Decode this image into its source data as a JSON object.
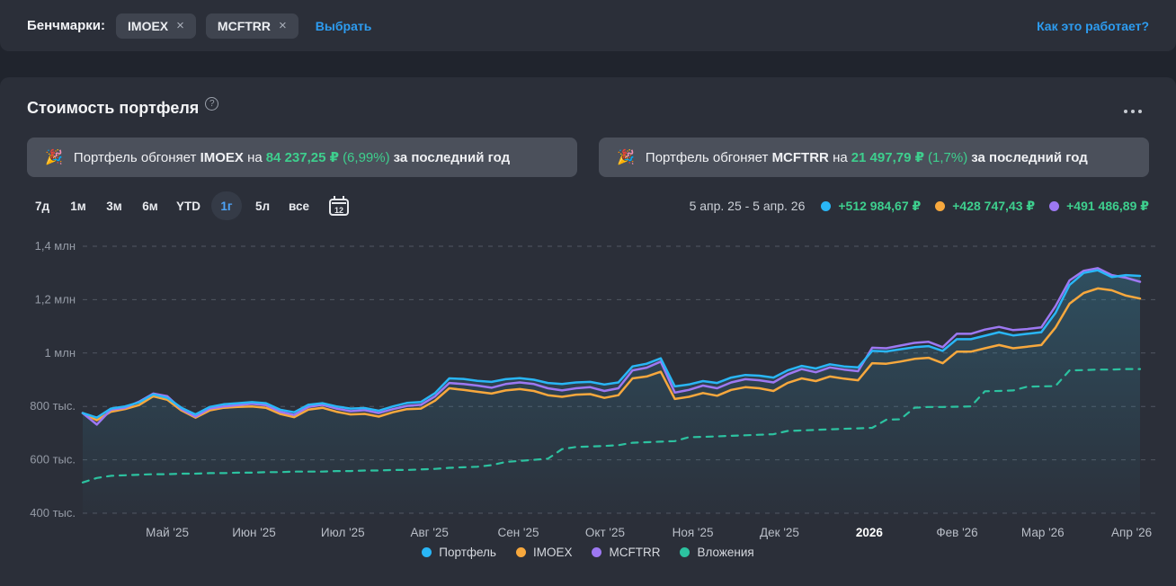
{
  "benchmark_bar": {
    "label": "Бенчмарки:",
    "chips": [
      {
        "label": "IMOEX"
      },
      {
        "label": "MCFTRR"
      }
    ],
    "remove_icon": "×",
    "select_link": "Выбрать",
    "help_link": "Как это работает?"
  },
  "portfolio_card": {
    "title": "Стоимость портфеля",
    "help_icon": "?",
    "banners": [
      {
        "emoji": "🎉",
        "prefix": "Портфель обгоняет",
        "benchmark": "IMOEX",
        "middle": "на",
        "amount": "84 237,25 ₽",
        "percent": "(6,99%)",
        "suffix": "за последний год"
      },
      {
        "emoji": "🎉",
        "prefix": "Портфель обгоняет",
        "benchmark": "MCFTRR",
        "middle": "на",
        "amount": "21 497,79 ₽",
        "percent": "(1,7%)",
        "suffix": "за последний год"
      }
    ],
    "periods": {
      "options": [
        "7д",
        "1м",
        "3м",
        "6м",
        "YTD",
        "1г",
        "5л",
        "все"
      ],
      "active": "1г",
      "calendar_label": "12"
    },
    "range": {
      "dates": "5 апр. 25 - 5 апр. 26",
      "stats": [
        {
          "color": "#29b6f6",
          "value": "+512 984,67 ₽"
        },
        {
          "color": "#f7a83d",
          "value": "+428 747,43 ₽"
        },
        {
          "color": "#9d78f2",
          "value": "+491 486,89 ₽"
        }
      ]
    }
  },
  "chart_data": {
    "type": "line",
    "title": "Стоимость портфеля",
    "unit": "тыс. ₽",
    "x_range": "5 апр. 25 - 5 апр. 26",
    "ylim": [
      370,
      1440
    ],
    "grid": "dashed-horizontal",
    "legend_position": "bottom-center",
    "y_ticks": [
      {
        "label": "1,4 млн",
        "value": 1400
      },
      {
        "label": "1,2 млн",
        "value": 1200
      },
      {
        "label": "1 млн",
        "value": 1000
      },
      {
        "label": "800 тыс.",
        "value": 800
      },
      {
        "label": "600 тыс.",
        "value": 600
      },
      {
        "label": "400 тыс.",
        "value": 400
      }
    ],
    "x_ticks": [
      {
        "label": "Май '25",
        "t": 0.08
      },
      {
        "label": "Июн '25",
        "t": 0.162
      },
      {
        "label": "Июл '25",
        "t": 0.246
      },
      {
        "label": "Авг '25",
        "t": 0.328
      },
      {
        "label": "Сен '25",
        "t": 0.412
      },
      {
        "label": "Окт '25",
        "t": 0.494
      },
      {
        "label": "Ноя '25",
        "t": 0.577
      },
      {
        "label": "Дек '25",
        "t": 0.659
      },
      {
        "label": "2026",
        "t": 0.744,
        "emphasis": true
      },
      {
        "label": "Фев '26",
        "t": 0.827
      },
      {
        "label": "Мар '26",
        "t": 0.908
      },
      {
        "label": "Апр '26",
        "t": 0.992
      }
    ],
    "series": [
      {
        "name": "Вложения",
        "color": "#2cc2a0",
        "dashed": true,
        "values": [
          515,
          532,
          540,
          542,
          544,
          546,
          546,
          548,
          548,
          550,
          550,
          552,
          552,
          554,
          554,
          556,
          556,
          556,
          558,
          558,
          560,
          560,
          562,
          562,
          564,
          566,
          570,
          572,
          574,
          580,
          592,
          596,
          600,
          604,
          640,
          648,
          650,
          652,
          655,
          664,
          666,
          668,
          670,
          685,
          686,
          688,
          690,
          692,
          694,
          696,
          708,
          710,
          712,
          714,
          716,
          718,
          720,
          750,
          752,
          795,
          798,
          798,
          799,
          800,
          857,
          858,
          860,
          874,
          875,
          876,
          935,
          936,
          938,
          938,
          940,
          940
        ]
      },
      {
        "name": "IMOEX",
        "color": "#f7a83d",
        "values": [
          775,
          748,
          780,
          790,
          805,
          838,
          825,
          785,
          758,
          785,
          795,
          798,
          800,
          795,
          772,
          760,
          788,
          795,
          780,
          770,
          772,
          762,
          778,
          790,
          792,
          822,
          868,
          862,
          855,
          848,
          860,
          865,
          858,
          842,
          836,
          844,
          846,
          832,
          842,
          905,
          912,
          930,
          828,
          836,
          850,
          840,
          862,
          872,
          868,
          858,
          888,
          905,
          895,
          912,
          904,
          898,
          962,
          960,
          968,
          978,
          982,
          962,
          1005,
          1005,
          1018,
          1030,
          1018,
          1024,
          1030,
          1095,
          1185,
          1225,
          1242,
          1235,
          1215,
          1204
        ]
      },
      {
        "name": "MCFTRR",
        "color": "#9d78f2",
        "values": [
          775,
          732,
          788,
          795,
          818,
          848,
          838,
          790,
          762,
          792,
          800,
          805,
          810,
          805,
          780,
          768,
          798,
          806,
          792,
          782,
          786,
          775,
          790,
          802,
          806,
          838,
          888,
          884,
          878,
          870,
          884,
          890,
          884,
          868,
          860,
          868,
          872,
          858,
          868,
          935,
          945,
          968,
          852,
          862,
          878,
          868,
          890,
          902,
          898,
          890,
          920,
          940,
          928,
          946,
          938,
          932,
          1020,
          1018,
          1028,
          1038,
          1042,
          1022,
          1072,
          1072,
          1088,
          1098,
          1086,
          1090,
          1096,
          1175,
          1272,
          1308,
          1318,
          1292,
          1282,
          1267
        ]
      },
      {
        "name": "Портфель",
        "color": "#29b6f6",
        "area": true,
        "values": [
          775,
          758,
          792,
          800,
          815,
          845,
          832,
          795,
          770,
          798,
          808,
          812,
          816,
          812,
          788,
          778,
          806,
          812,
          800,
          792,
          794,
          784,
          800,
          813,
          817,
          850,
          905,
          903,
          896,
          892,
          902,
          906,
          900,
          888,
          884,
          890,
          892,
          882,
          890,
          950,
          960,
          980,
          875,
          882,
          895,
          888,
          908,
          918,
          915,
          908,
          935,
          952,
          942,
          958,
          950,
          946,
          1008,
          1006,
          1014,
          1022,
          1026,
          1008,
          1052,
          1052,
          1065,
          1078,
          1066,
          1072,
          1078,
          1150,
          1255,
          1300,
          1310,
          1285,
          1292,
          1289
        ]
      }
    ],
    "legend": [
      {
        "label": "Портфель",
        "color": "#29b6f6"
      },
      {
        "label": "IMOEX",
        "color": "#f7a83d"
      },
      {
        "label": "MCFTRR",
        "color": "#9d78f2"
      },
      {
        "label": "Вложения",
        "color": "#2cc2a0"
      }
    ]
  }
}
